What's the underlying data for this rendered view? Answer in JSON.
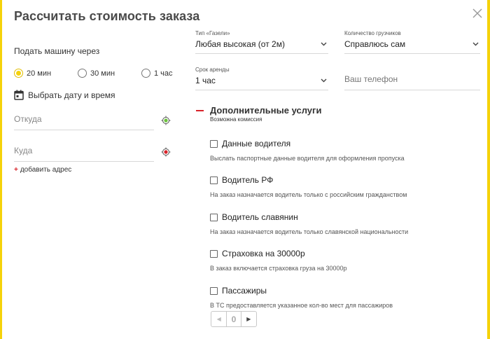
{
  "modal": {
    "title": "Рассчитать стоимость заказа"
  },
  "pickup": {
    "label": "Подать машину через",
    "options": [
      {
        "label": "20 мин",
        "selected": true
      },
      {
        "label": "30 мин",
        "selected": false
      },
      {
        "label": "1 час",
        "selected": false
      }
    ],
    "date_link": "Выбрать дату и время"
  },
  "address": {
    "from_placeholder": "Откуда",
    "to_placeholder": "Куда",
    "add_label": "добавить адрес"
  },
  "order": {
    "gazelle_type": {
      "caption": "Тип «Газели»",
      "value": "Любая высокая (от 2м)"
    },
    "movers": {
      "caption": "Количество грузчиков",
      "value": "Справлюсь сам"
    },
    "rent": {
      "caption": "Срок аренды",
      "value": "1 час"
    },
    "phone_placeholder": "Ваш телефон"
  },
  "extras": {
    "title": "Дополнительные услуги",
    "note": "Возможна комиссия",
    "services": [
      {
        "label": "Данные водителя",
        "desc": "Выслать паспортные данные водителя для оформления пропуска",
        "checked": false
      },
      {
        "label": "Водитель РФ",
        "desc": "На заказ назначается водитель только с российским гражданством",
        "checked": false
      },
      {
        "label": "Водитель славянин",
        "desc": "На заказ назначается водитель только славянской национальности",
        "checked": false
      },
      {
        "label": "Страховка на 30000р",
        "desc": "В заказ включается страховка груза на 30000р",
        "checked": false
      },
      {
        "label": "Пассажиры",
        "desc": "В ТС предоставляется указанное кол-во мест для пассажиров",
        "checked": false
      }
    ],
    "passengers": {
      "value": "0",
      "prev": "◀",
      "next": "▶"
    }
  },
  "colors": {
    "accent": "#f5d20a",
    "red": "#d8232a",
    "green_marker": "#6cc13c"
  }
}
